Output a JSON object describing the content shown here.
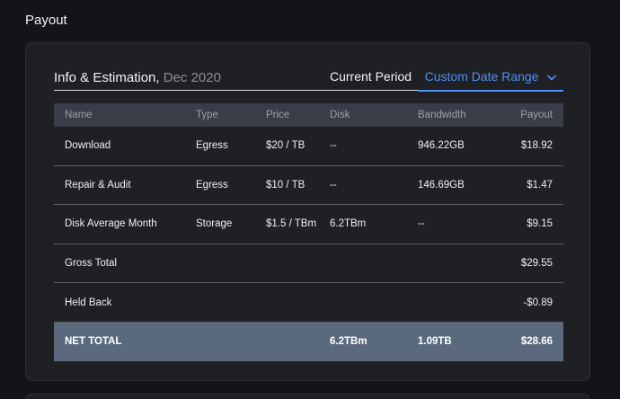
{
  "page": {
    "title": "Payout"
  },
  "header": {
    "title": "Info & Estimation,",
    "period": "Dec 2020",
    "tabs": {
      "current": "Current Period",
      "custom": "Custom Date Range"
    }
  },
  "table": {
    "columns": {
      "name": "Name",
      "type": "Type",
      "price": "Price",
      "disk": "Disk",
      "bandwidth": "Bandwidth",
      "payout": "Payout"
    },
    "rows": [
      {
        "name": "Download",
        "type": "Egress",
        "price": "$20 / TB",
        "disk": "--",
        "bandwidth": "946.22GB",
        "payout": "$18.92"
      },
      {
        "name": "Repair & Audit",
        "type": "Egress",
        "price": "$10 / TB",
        "disk": "--",
        "bandwidth": "146.69GB",
        "payout": "$1.47"
      },
      {
        "name": "Disk Average Month",
        "type": "Storage",
        "price": "$1.5 / TBm",
        "disk": "6.2TBm",
        "bandwidth": "--",
        "payout": "$9.15"
      },
      {
        "name": "Gross Total",
        "type": "",
        "price": "",
        "disk": "",
        "bandwidth": "",
        "payout": "$29.55"
      },
      {
        "name": "Held Back",
        "type": "",
        "price": "",
        "disk": "",
        "bandwidth": "",
        "payout": "-$0.89"
      }
    ],
    "net": {
      "name": "NET TOTAL",
      "disk": "6.2TBm",
      "bandwidth": "1.09TB",
      "payout": "$28.66"
    }
  },
  "colors": {
    "accent": "#4f8ff7",
    "net_row": "#5a6a7c",
    "header_row": "#393d47"
  },
  "icons": {
    "dropdown": "chevron-down-icon"
  }
}
